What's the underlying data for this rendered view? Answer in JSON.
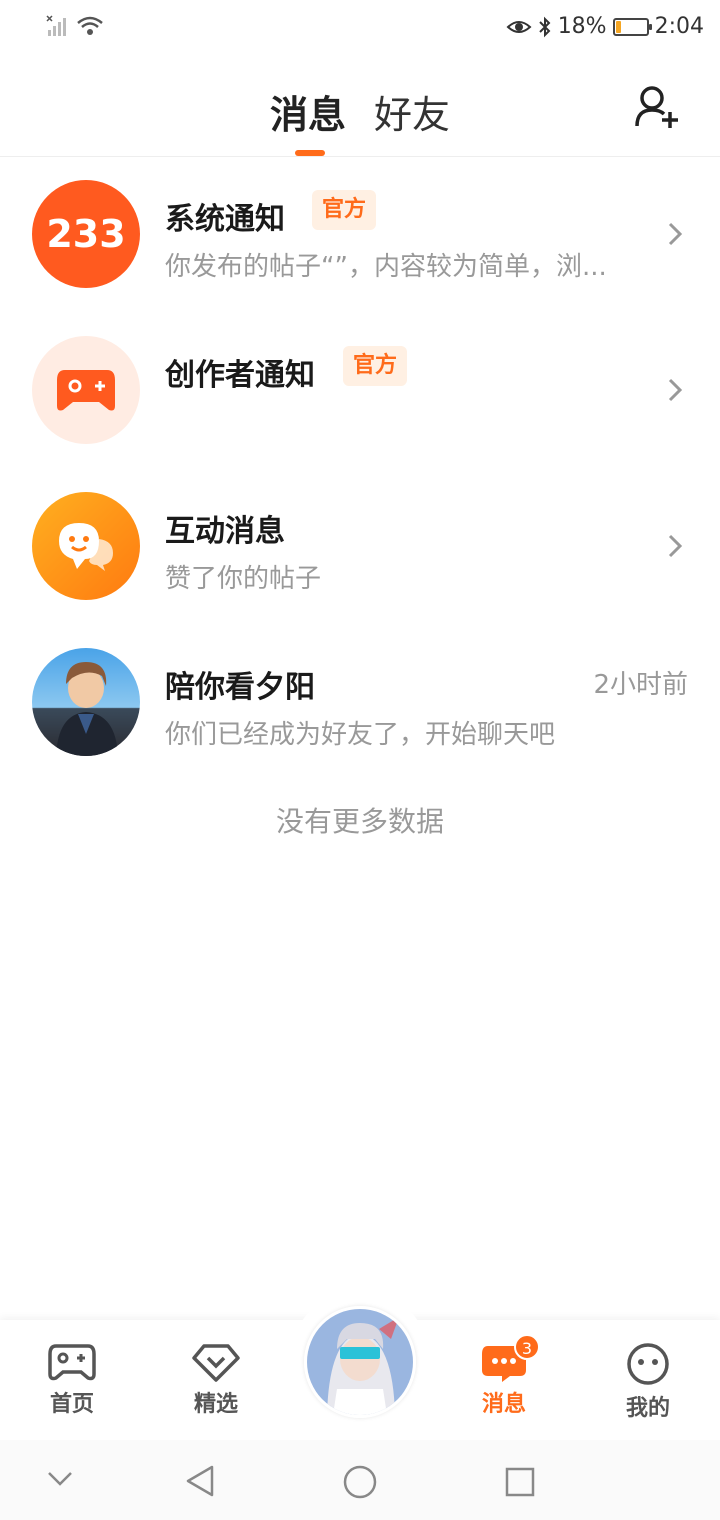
{
  "status_bar": {
    "eye": "eye-icon",
    "bluetooth": "bluetooth-icon",
    "battery_pct": "18%",
    "battery_level": 0.18,
    "time": "2:04"
  },
  "header": {
    "tab_messages": "消息",
    "tab_friends": "好友",
    "add_friend_icon": "add-user-icon"
  },
  "messages": [
    {
      "title": "系统通知",
      "badge": "官方",
      "subtitle": "你发布的帖子“”，内容较为简单，浏...",
      "avatar_text": "233"
    },
    {
      "title": "创作者通知",
      "badge": "官方",
      "subtitle": ""
    },
    {
      "title": "互动消息",
      "subtitle": "赞了你的帖子"
    },
    {
      "title": "陪你看夕阳",
      "subtitle": "你们已经成为好友了，开始聊天吧",
      "time": "2小时前"
    }
  ],
  "no_more": "没有更多数据",
  "nav": {
    "home": "首页",
    "featured": "精选",
    "messages": "消息",
    "messages_badge": "3",
    "me": "我的"
  },
  "colors": {
    "accent": "#ff6b1a",
    "badge_bg": "#fff0e3"
  }
}
